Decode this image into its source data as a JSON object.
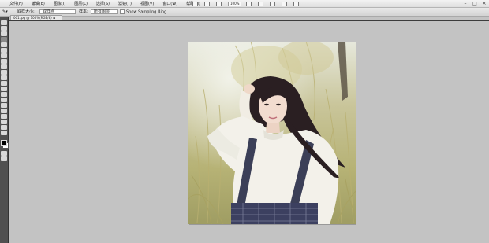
{
  "menubar": {
    "items": [
      "文件(F)",
      "编辑(E)",
      "图像(I)",
      "图层(L)",
      "选择(S)",
      "滤镜(T)",
      "视图(V)",
      "窗口(W)",
      "帮助(H)"
    ],
    "zoom": "100%"
  },
  "options": {
    "sample_size_label": "取样大小:",
    "sample_size_value": "取样点",
    "sample_label": "样本:",
    "sample_value": "所有图层",
    "show_ring_label": "Show Sampling Ring"
  },
  "document": {
    "tab_title": "001.jpg @ 100%(RGB/8) ⊠"
  },
  "colors": {
    "foreground": "#000000",
    "background": "#ffffff",
    "workspace": "#c3c3c3"
  },
  "photo": {
    "subject": "portrait-photo"
  }
}
